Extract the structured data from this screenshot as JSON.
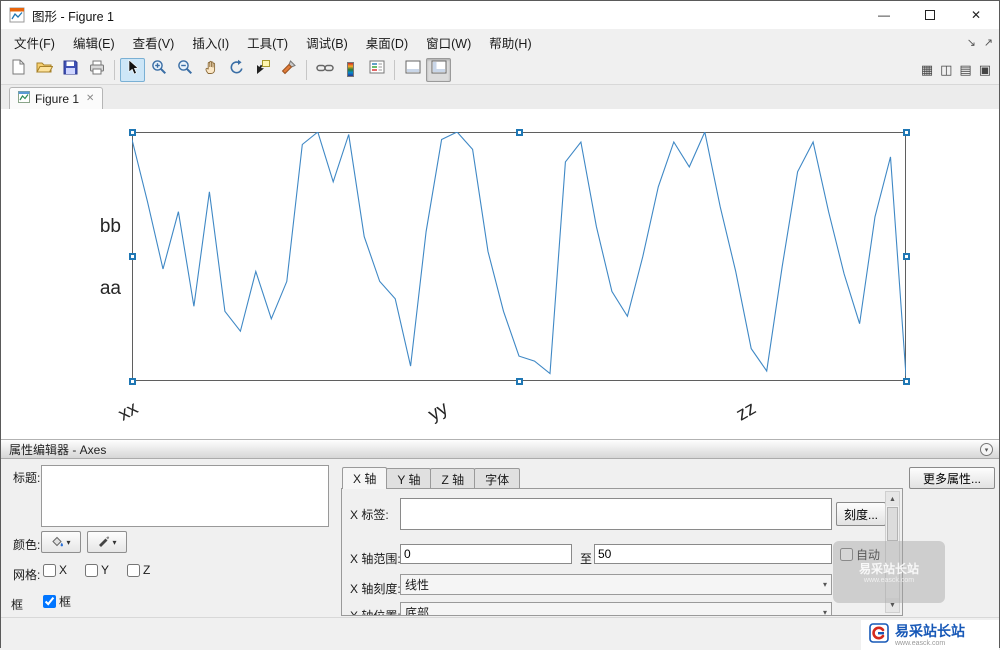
{
  "window": {
    "title": "图形 - Figure 1",
    "controls": {
      "minimize": "—",
      "close": "✕"
    }
  },
  "menu": {
    "items": [
      "文件(F)",
      "编辑(E)",
      "查看(V)",
      "插入(I)",
      "工具(T)",
      "调试(B)",
      "桌面(D)",
      "窗口(W)",
      "帮助(H)"
    ]
  },
  "icons": {
    "dock": "↘",
    "undock": "↗",
    "layout_grid": "▦",
    "layout_split_vertical": "◫",
    "layout_split_horizontal": "▤",
    "layout_float": "▣",
    "scroll_up": "▲",
    "scroll_down": "▼",
    "combo_arrow": "▾",
    "collapse": "▾",
    "tab_close": "✕",
    "color_dropdown_arrow": "▾"
  },
  "toolbar": {
    "icon_names": [
      "new-figure",
      "open-file",
      "save-figure",
      "print-figure",
      "edit-plot",
      "zoom-in",
      "zoom-out",
      "pan",
      "rotate-3d",
      "data-cursor",
      "brush-data",
      "link-plot",
      "insert-colorbar",
      "insert-legend",
      "hide-plot-tools",
      "show-plot-tools"
    ]
  },
  "tabbar": {
    "figure_tab": "Figure 1"
  },
  "chart_data": {
    "type": "line",
    "title": "",
    "xlabel": "",
    "ylabel": "",
    "xlim": [
      0,
      50
    ],
    "ylim": [
      0,
      1
    ],
    "grid": false,
    "line_color": "#3f88c5",
    "selected": true,
    "xticks": [
      0,
      20,
      40
    ],
    "xticklabels": [
      "xx",
      "yy",
      "zz"
    ],
    "yticklabels": [
      "bb",
      "aa"
    ],
    "ytick_fractions_from_top": [
      0.385,
      0.635
    ],
    "values": [
      0.97,
      0.72,
      0.45,
      0.68,
      0.3,
      0.76,
      0.28,
      0.2,
      0.44,
      0.25,
      0.4,
      0.95,
      1.0,
      0.8,
      0.99,
      0.58,
      0.4,
      0.33,
      0.06,
      0.6,
      0.97,
      1.0,
      0.93,
      0.52,
      0.28,
      0.1,
      0.08,
      0.03,
      0.88,
      0.96,
      0.62,
      0.36,
      0.26,
      0.5,
      0.78,
      0.96,
      0.86,
      1.0,
      0.7,
      0.44,
      0.13,
      0.04,
      0.46,
      0.84,
      0.96,
      0.68,
      0.43,
      0.23,
      0.66,
      0.9,
      0.02
    ]
  },
  "property_editor": {
    "header": "属性编辑器 - Axes",
    "title_label": "标题:",
    "title_value": "",
    "color_label": "颜色:",
    "grid_label": "网格:",
    "grid_x": "X",
    "grid_y": "Y",
    "grid_z": "Z",
    "grid_x_checked": false,
    "grid_y_checked": false,
    "grid_z_checked": false,
    "box_label": "框",
    "box_check_label": "框",
    "box_checked": true,
    "tabs": [
      "X 轴",
      "Y 轴",
      "Z 轴",
      "字体"
    ],
    "active_tab": "X 轴",
    "xlabel_label": "X 标签:",
    "xlabel_value": "",
    "ticks_button": "刻度...",
    "range_label": "X 轴范围:",
    "range_min": "0",
    "range_to_label": "至",
    "range_max": "50",
    "auto_label": "自动",
    "auto_checked": false,
    "scale_label": "X 轴刻度:",
    "scale_value": "线性",
    "position_label": "X 轴位置:",
    "position_value": "底部",
    "more_properties_button": "更多属性..."
  },
  "watermark": {
    "brand": "易采站长站",
    "sub": "www.easck.com"
  }
}
